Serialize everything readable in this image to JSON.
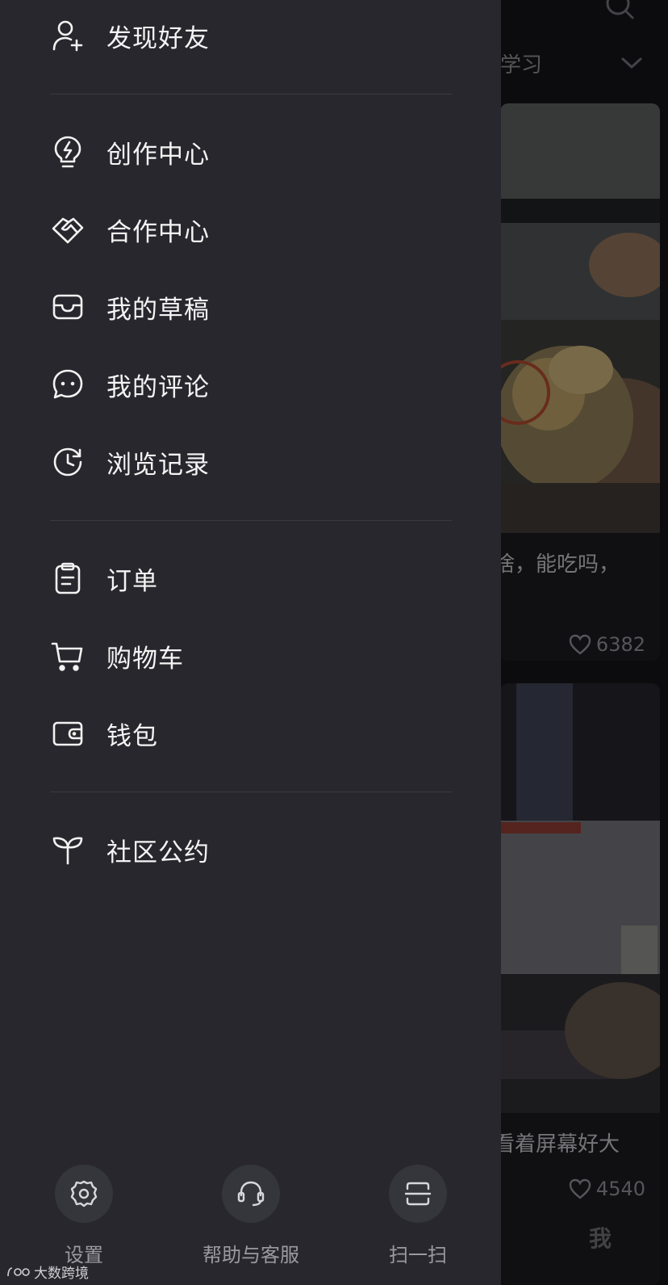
{
  "feed": {
    "tab_label": "学习",
    "cards": [
      {
        "title": "啥，能吃吗，",
        "likes": "6382"
      },
      {
        "title": "看着屏幕好大",
        "likes": "4540"
      }
    ],
    "me_tab": "我"
  },
  "drawer": {
    "group1": [
      {
        "icon": "add-friend-icon",
        "label": "发现好友"
      }
    ],
    "group2": [
      {
        "icon": "lightning-bulb-icon",
        "label": "创作中心"
      },
      {
        "icon": "handshake-icon",
        "label": "合作中心"
      },
      {
        "icon": "inbox-icon",
        "label": "我的草稿"
      },
      {
        "icon": "comment-icon",
        "label": "我的评论"
      },
      {
        "icon": "history-clock-icon",
        "label": "浏览记录"
      }
    ],
    "group3": [
      {
        "icon": "clipboard-icon",
        "label": "订单"
      },
      {
        "icon": "cart-icon",
        "label": "购物车"
      },
      {
        "icon": "wallet-icon",
        "label": "钱包"
      }
    ],
    "group4": [
      {
        "icon": "sprout-icon",
        "label": "社区公约"
      }
    ],
    "bottom_actions": [
      {
        "icon": "gear-icon",
        "label": "设置"
      },
      {
        "icon": "headset-icon",
        "label": "帮助与客服"
      },
      {
        "icon": "scan-icon",
        "label": "扫一扫"
      }
    ]
  },
  "watermark": "大数跨境",
  "colors": {
    "drawer_bg": "#27272d",
    "text_primary": "#f4f4f5",
    "text_secondary": "#9a9aa0",
    "divider": "#3a3a41"
  }
}
